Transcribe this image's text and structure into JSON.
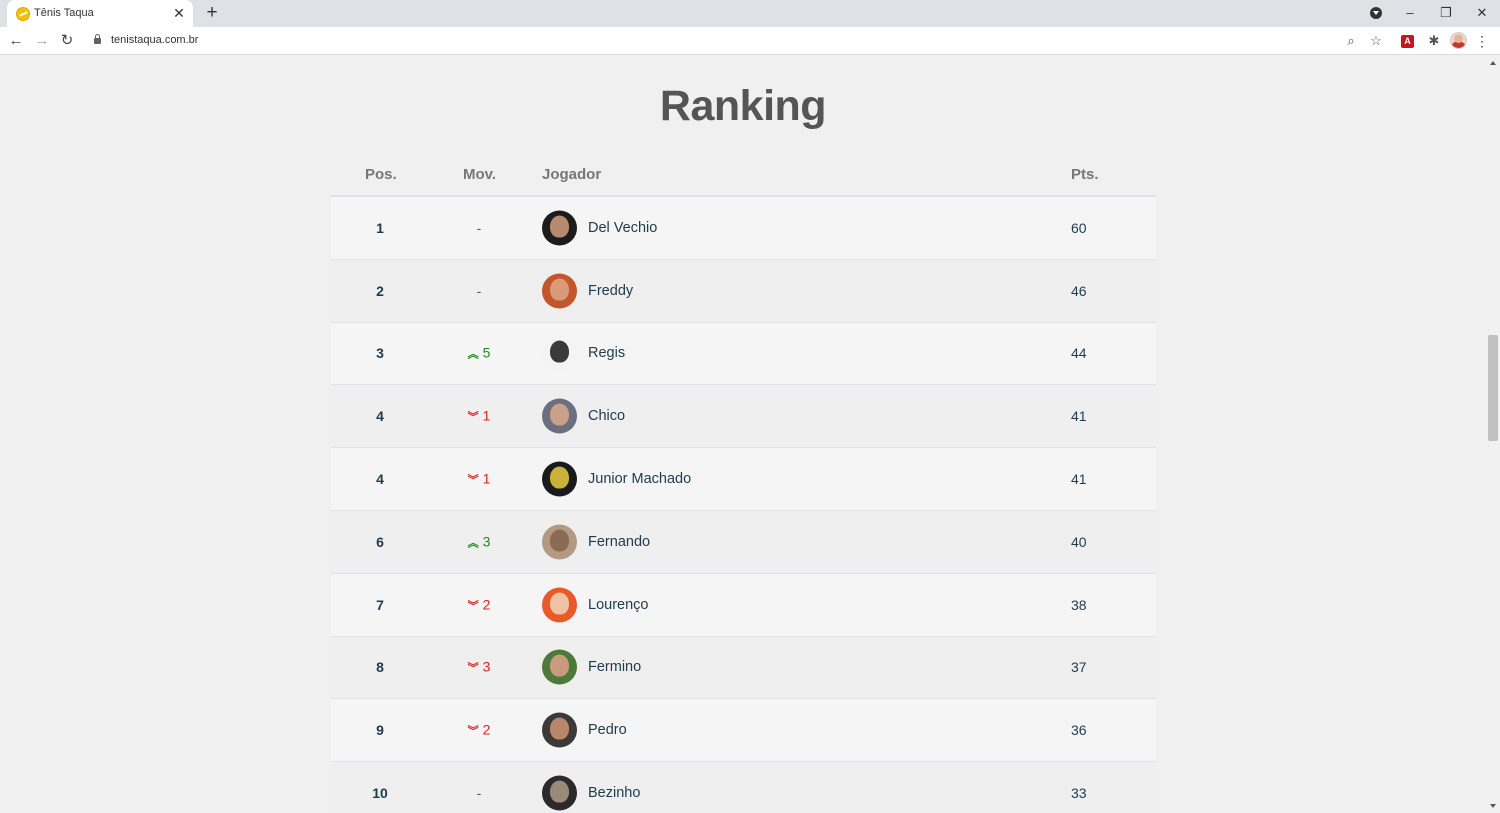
{
  "browser": {
    "tab_title": "Tênis Taqua",
    "url": "tenistaqua.com.br",
    "new_tab_label": "+",
    "tab_close_label": "✕"
  },
  "page": {
    "heading": "Ranking",
    "columns": {
      "pos": "Pos.",
      "mov": "Mov.",
      "player": "Jogador",
      "pts": "Pts."
    },
    "rows": [
      {
        "pos": "1",
        "mov": "-",
        "dir": "none",
        "name": "Del Vechio",
        "pts": "60",
        "bg": "#1c1c1c",
        "face": "#b58a6e"
      },
      {
        "pos": "2",
        "mov": "-",
        "dir": "none",
        "name": "Freddy",
        "pts": "46",
        "bg": "#c4562c",
        "face": "#d99a78"
      },
      {
        "pos": "3",
        "mov": "5",
        "dir": "up",
        "name": "Regis",
        "pts": "44",
        "bg": "#f4f4f4",
        "face": "#3a3a3a"
      },
      {
        "pos": "4",
        "mov": "1",
        "dir": "down",
        "name": "Chico",
        "pts": "41",
        "bg": "#6c6f7d",
        "face": "#c9a08a"
      },
      {
        "pos": "4",
        "mov": "1",
        "dir": "down",
        "name": "Junior Machado",
        "pts": "41",
        "bg": "#1a1a1a",
        "face": "#c9b23a"
      },
      {
        "pos": "6",
        "mov": "3",
        "dir": "up",
        "name": "Fernando",
        "pts": "40",
        "bg": "#b49a82",
        "face": "#8a6a52"
      },
      {
        "pos": "7",
        "mov": "2",
        "dir": "down",
        "name": "Lourenço",
        "pts": "38",
        "bg": "#e85a2a",
        "face": "#f0c2a4"
      },
      {
        "pos": "8",
        "mov": "3",
        "dir": "down",
        "name": "Fermino",
        "pts": "37",
        "bg": "#4d7a3a",
        "face": "#c99a7e"
      },
      {
        "pos": "9",
        "mov": "2",
        "dir": "down",
        "name": "Pedro",
        "pts": "36",
        "bg": "#3c3a38",
        "face": "#b8876a"
      },
      {
        "pos": "10",
        "mov": "-",
        "dir": "none",
        "name": "Bezinho",
        "pts": "33",
        "bg": "#2a2a2a",
        "face": "#9a8a7a"
      }
    ]
  },
  "colors": {
    "up": "#1e8a1e",
    "down": "#dd2222",
    "text": "#1f3b4d"
  }
}
